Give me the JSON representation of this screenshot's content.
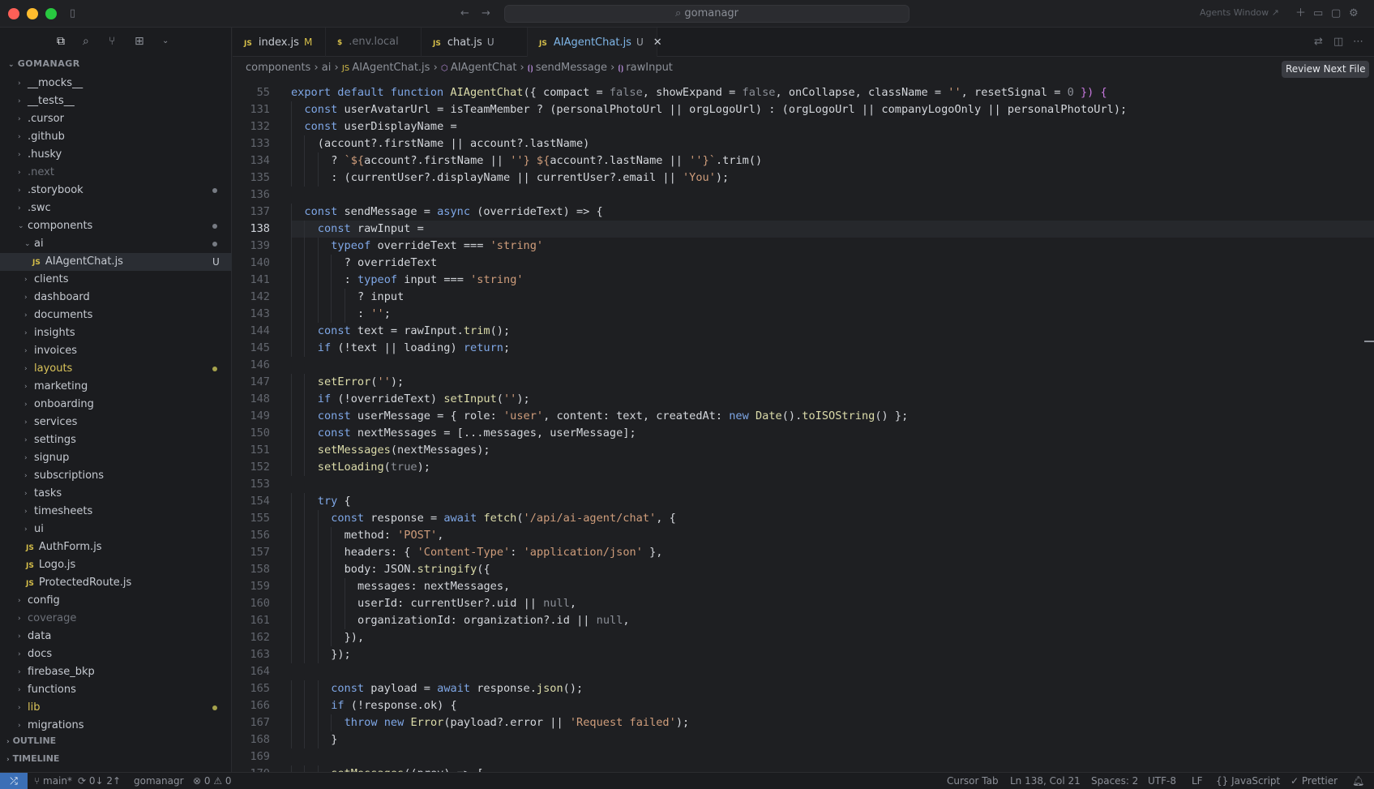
{
  "window": {
    "search": "gomanagr",
    "agents": "Agents Window ↗",
    "colors": {
      "red": "#fe5f57",
      "yellow": "#febc2e",
      "green": "#28c840",
      "accent": "#7fb6e8"
    }
  },
  "sidebar": {
    "title": "GOMANAGR",
    "items": [
      {
        "label": "__mocks__",
        "depth": 0,
        "type": "folder",
        "open": false
      },
      {
        "label": "__tests__",
        "depth": 0,
        "type": "folder",
        "open": false
      },
      {
        "label": ".cursor",
        "depth": 0,
        "type": "folder",
        "open": false
      },
      {
        "label": ".github",
        "depth": 0,
        "type": "folder",
        "open": false
      },
      {
        "label": ".husky",
        "depth": 0,
        "type": "folder",
        "open": false
      },
      {
        "label": ".next",
        "depth": 0,
        "type": "folder",
        "open": false,
        "muted": true
      },
      {
        "label": ".storybook",
        "depth": 0,
        "type": "folder",
        "open": false,
        "dot": "grey"
      },
      {
        "label": ".swc",
        "depth": 0,
        "type": "folder",
        "open": false
      },
      {
        "label": "components",
        "depth": 0,
        "type": "folder",
        "open": true,
        "dot": "grey"
      },
      {
        "label": "ai",
        "depth": 1,
        "type": "folder",
        "open": true,
        "dot": "grey"
      },
      {
        "label": "AIAgentChat.js",
        "depth": 2,
        "type": "js",
        "selected": true,
        "badge": "U"
      },
      {
        "label": "clients",
        "depth": 1,
        "type": "folder",
        "open": false
      },
      {
        "label": "dashboard",
        "depth": 1,
        "type": "folder",
        "open": false
      },
      {
        "label": "documents",
        "depth": 1,
        "type": "folder",
        "open": false
      },
      {
        "label": "insights",
        "depth": 1,
        "type": "folder",
        "open": false
      },
      {
        "label": "invoices",
        "depth": 1,
        "type": "folder",
        "open": false
      },
      {
        "label": "layouts",
        "depth": 1,
        "type": "folder",
        "open": false,
        "yellow": true,
        "dot": "yellow"
      },
      {
        "label": "marketing",
        "depth": 1,
        "type": "folder",
        "open": false
      },
      {
        "label": "onboarding",
        "depth": 1,
        "type": "folder",
        "open": false
      },
      {
        "label": "services",
        "depth": 1,
        "type": "folder",
        "open": false
      },
      {
        "label": "settings",
        "depth": 1,
        "type": "folder",
        "open": false
      },
      {
        "label": "signup",
        "depth": 1,
        "type": "folder",
        "open": false
      },
      {
        "label": "subscriptions",
        "depth": 1,
        "type": "folder",
        "open": false
      },
      {
        "label": "tasks",
        "depth": 1,
        "type": "folder",
        "open": false
      },
      {
        "label": "timesheets",
        "depth": 1,
        "type": "folder",
        "open": false
      },
      {
        "label": "ui",
        "depth": 1,
        "type": "folder",
        "open": false
      },
      {
        "label": "AuthForm.js",
        "depth": 1,
        "type": "js"
      },
      {
        "label": "Logo.js",
        "depth": 1,
        "type": "js"
      },
      {
        "label": "ProtectedRoute.js",
        "depth": 1,
        "type": "js"
      },
      {
        "label": "config",
        "depth": 0,
        "type": "folder",
        "open": false
      },
      {
        "label": "coverage",
        "depth": 0,
        "type": "folder",
        "open": false,
        "muted": true
      },
      {
        "label": "data",
        "depth": 0,
        "type": "folder",
        "open": false
      },
      {
        "label": "docs",
        "depth": 0,
        "type": "folder",
        "open": false
      },
      {
        "label": "firebase_bkp",
        "depth": 0,
        "type": "folder",
        "open": false
      },
      {
        "label": "functions",
        "depth": 0,
        "type": "folder",
        "open": false
      },
      {
        "label": "lib",
        "depth": 0,
        "type": "folder",
        "open": false,
        "yellow": true,
        "dot": "yellow"
      },
      {
        "label": "migrations",
        "depth": 0,
        "type": "folder",
        "open": false
      }
    ],
    "outline": "OUTLINE",
    "timeline": "TIMELINE"
  },
  "tabs": [
    {
      "label": "index.js",
      "icon": "JS",
      "badge": "M"
    },
    {
      "label": ".env.local",
      "icon": "$",
      "badge": ""
    },
    {
      "label": "chat.js",
      "icon": "JS",
      "badge": "U"
    },
    {
      "label": "AIAgentChat.js",
      "icon": "JS",
      "badge": "U",
      "active": true
    }
  ],
  "breadcrumb": [
    "components",
    "ai",
    "AIAgentChat.js",
    "AIAgentChat",
    "sendMessage",
    "rawInput"
  ],
  "review_button": "Review Next File",
  "code": {
    "current_line": 138,
    "lines": [
      {
        "n": 55,
        "indent": 0,
        "t": [
          [
            "k",
            "export default function "
          ],
          [
            "f",
            "AIAgentChat"
          ],
          [
            "",
            "({ compact = "
          ],
          [
            "n",
            "false"
          ],
          [
            "",
            ", showExpand = "
          ],
          [
            "n",
            "false"
          ],
          [
            "",
            ", onCollapse, className = "
          ],
          [
            "s",
            "''"
          ],
          [
            "",
            ", resetSignal = "
          ],
          [
            "n",
            "0"
          ],
          [
            "p",
            " }) {"
          ]
        ]
      },
      {
        "n": 131,
        "indent": 1,
        "t": [
          [
            "k",
            "const "
          ],
          [
            "",
            "userAvatarUrl = isTeamMember ? (personalPhotoUrl || orgLogoUrl) : (orgLogoUrl || companyLogoOnly || personalPhotoUrl);"
          ]
        ]
      },
      {
        "n": 132,
        "indent": 1,
        "t": [
          [
            "k",
            "const "
          ],
          [
            "",
            "userDisplayName ="
          ]
        ]
      },
      {
        "n": 133,
        "indent": 2,
        "t": [
          [
            "",
            "(account?.firstName || account?.lastName)"
          ]
        ]
      },
      {
        "n": 134,
        "indent": 3,
        "t": [
          [
            "",
            "? "
          ],
          [
            "s",
            "`${"
          ],
          [
            "",
            "account?.firstName || "
          ],
          [
            "s",
            "''"
          ],
          [
            "s",
            "} ${"
          ],
          [
            "",
            "account?.lastName || "
          ],
          [
            "s",
            "''"
          ],
          [
            "s",
            "}`"
          ],
          [
            "",
            ".trim()"
          ]
        ]
      },
      {
        "n": 135,
        "indent": 3,
        "t": [
          [
            "",
            ": (currentUser?.displayName || currentUser?.email || "
          ],
          [
            "s",
            "'You'"
          ],
          [
            "",
            ");"
          ]
        ]
      },
      {
        "n": 136,
        "indent": 0,
        "t": []
      },
      {
        "n": 137,
        "indent": 1,
        "t": [
          [
            "k",
            "const "
          ],
          [
            "",
            "sendMessage = "
          ],
          [
            "k",
            "async "
          ],
          [
            "",
            "(overrideText) => {"
          ]
        ]
      },
      {
        "n": 138,
        "indent": 2,
        "t": [
          [
            "k",
            "const "
          ],
          [
            "",
            "rawInput ="
          ]
        ]
      },
      {
        "n": 139,
        "indent": 3,
        "t": [
          [
            "k",
            "typeof "
          ],
          [
            "",
            "overrideText === "
          ],
          [
            "s",
            "'string'"
          ]
        ]
      },
      {
        "n": 140,
        "indent": 4,
        "t": [
          [
            "",
            "? overrideText"
          ]
        ]
      },
      {
        "n": 141,
        "indent": 4,
        "t": [
          [
            "",
            ": "
          ],
          [
            "k",
            "typeof "
          ],
          [
            "",
            "input === "
          ],
          [
            "s",
            "'string'"
          ]
        ]
      },
      {
        "n": 142,
        "indent": 5,
        "t": [
          [
            "",
            "? input"
          ]
        ]
      },
      {
        "n": 143,
        "indent": 5,
        "t": [
          [
            "",
            ": "
          ],
          [
            "s",
            "''"
          ],
          [
            "",
            ";"
          ]
        ]
      },
      {
        "n": 144,
        "indent": 2,
        "t": [
          [
            "k",
            "const "
          ],
          [
            "",
            "text = rawInput."
          ],
          [
            "f",
            "trim"
          ],
          [
            "",
            "();"
          ]
        ]
      },
      {
        "n": 145,
        "indent": 2,
        "t": [
          [
            "k",
            "if "
          ],
          [
            "",
            "(!text || loading) "
          ],
          [
            "k",
            "return"
          ],
          [
            "",
            ";"
          ]
        ]
      },
      {
        "n": 146,
        "indent": 0,
        "t": []
      },
      {
        "n": 147,
        "indent": 2,
        "t": [
          [
            "f",
            "setError"
          ],
          [
            "",
            "("
          ],
          [
            "s",
            "''"
          ],
          [
            "",
            ");"
          ]
        ]
      },
      {
        "n": 148,
        "indent": 2,
        "t": [
          [
            "k",
            "if "
          ],
          [
            "",
            "(!overrideText) "
          ],
          [
            "f",
            "setInput"
          ],
          [
            "",
            "("
          ],
          [
            "s",
            "''"
          ],
          [
            "",
            ");"
          ]
        ]
      },
      {
        "n": 149,
        "indent": 2,
        "t": [
          [
            "k",
            "const "
          ],
          [
            "",
            "userMessage = { role: "
          ],
          [
            "s",
            "'user'"
          ],
          [
            "",
            ", content: text, createdAt: "
          ],
          [
            "k",
            "new "
          ],
          [
            "f",
            "Date"
          ],
          [
            "",
            "()."
          ],
          [
            "f",
            "toISOString"
          ],
          [
            "",
            "() };"
          ]
        ]
      },
      {
        "n": 150,
        "indent": 2,
        "t": [
          [
            "k",
            "const "
          ],
          [
            "",
            "nextMessages = [...messages, userMessage];"
          ]
        ]
      },
      {
        "n": 151,
        "indent": 2,
        "t": [
          [
            "f",
            "setMessages"
          ],
          [
            "",
            "(nextMessages);"
          ]
        ]
      },
      {
        "n": 152,
        "indent": 2,
        "t": [
          [
            "f",
            "setLoading"
          ],
          [
            "",
            "("
          ],
          [
            "n",
            "true"
          ],
          [
            "",
            ");"
          ]
        ]
      },
      {
        "n": 153,
        "indent": 0,
        "t": []
      },
      {
        "n": 154,
        "indent": 2,
        "t": [
          [
            "k",
            "try "
          ],
          [
            "",
            "{"
          ]
        ]
      },
      {
        "n": 155,
        "indent": 3,
        "t": [
          [
            "k",
            "const "
          ],
          [
            "",
            "response = "
          ],
          [
            "k",
            "await "
          ],
          [
            "f",
            "fetch"
          ],
          [
            "",
            "("
          ],
          [
            "s",
            "'/api/ai-agent/chat'"
          ],
          [
            "",
            ", {"
          ]
        ]
      },
      {
        "n": 156,
        "indent": 4,
        "t": [
          [
            "",
            "method: "
          ],
          [
            "s",
            "'POST'"
          ],
          [
            "",
            ","
          ]
        ]
      },
      {
        "n": 157,
        "indent": 4,
        "t": [
          [
            "",
            "headers: { "
          ],
          [
            "s",
            "'Content-Type'"
          ],
          [
            "",
            ": "
          ],
          [
            "s",
            "'application/json'"
          ],
          [
            "",
            " },"
          ]
        ]
      },
      {
        "n": 158,
        "indent": 4,
        "t": [
          [
            "",
            "body: JSON."
          ],
          [
            "f",
            "stringify"
          ],
          [
            "",
            "({"
          ]
        ]
      },
      {
        "n": 159,
        "indent": 5,
        "t": [
          [
            "",
            "messages: nextMessages,"
          ]
        ]
      },
      {
        "n": 160,
        "indent": 5,
        "t": [
          [
            "",
            "userId: currentUser?.uid || "
          ],
          [
            "n",
            "null"
          ],
          [
            "",
            ","
          ]
        ]
      },
      {
        "n": 161,
        "indent": 5,
        "t": [
          [
            "",
            "organizationId: organization?.id || "
          ],
          [
            "n",
            "null"
          ],
          [
            "",
            ","
          ]
        ]
      },
      {
        "n": 162,
        "indent": 4,
        "t": [
          [
            "",
            "}),"
          ]
        ]
      },
      {
        "n": 163,
        "indent": 3,
        "t": [
          [
            "",
            "});"
          ]
        ]
      },
      {
        "n": 164,
        "indent": 0,
        "t": []
      },
      {
        "n": 165,
        "indent": 3,
        "t": [
          [
            "k",
            "const "
          ],
          [
            "",
            "payload = "
          ],
          [
            "k",
            "await "
          ],
          [
            "",
            "response."
          ],
          [
            "f",
            "json"
          ],
          [
            "",
            "();"
          ]
        ]
      },
      {
        "n": 166,
        "indent": 3,
        "t": [
          [
            "k",
            "if "
          ],
          [
            "",
            "(!response.ok) {"
          ]
        ]
      },
      {
        "n": 167,
        "indent": 4,
        "t": [
          [
            "k",
            "throw new "
          ],
          [
            "f",
            "Error"
          ],
          [
            "",
            "(payload?.error || "
          ],
          [
            "s",
            "'Request failed'"
          ],
          [
            "",
            ");"
          ]
        ]
      },
      {
        "n": 168,
        "indent": 3,
        "t": [
          [
            "",
            "}"
          ]
        ]
      },
      {
        "n": 169,
        "indent": 0,
        "t": []
      },
      {
        "n": 170,
        "indent": 3,
        "t": [
          [
            "f",
            "setMessages"
          ],
          [
            "",
            "((prev) => ["
          ]
        ]
      }
    ]
  },
  "status": {
    "branch": "main*",
    "sync": "0↓ 2↑",
    "workspace": "gomanagr",
    "problems": "⊗ 0 ⚠ 0",
    "cursor_tab": "Cursor Tab",
    "position": "Ln 138, Col 21",
    "spaces": "Spaces: 2",
    "encoding": "UTF-8",
    "eol": "LF",
    "language": "{} JavaScript",
    "formatter": "✓ Prettier"
  }
}
